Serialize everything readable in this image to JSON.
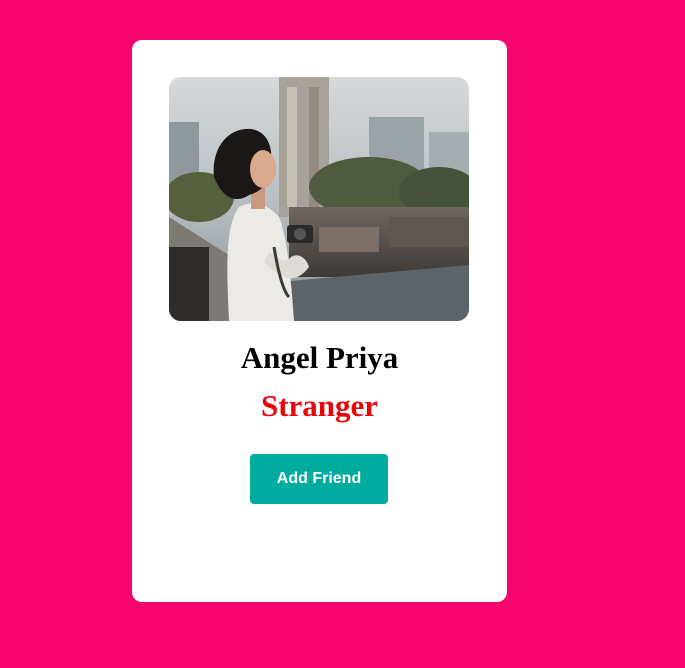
{
  "colors": {
    "background": "#f5066f",
    "card": "#ffffff",
    "name_text": "#000000",
    "status_text": "#e8060a",
    "button": "#00aba0",
    "button_text": "#ffffff"
  },
  "profile": {
    "photo_icon": "profile-photo",
    "name": "Angel Priya",
    "status": "Stranger"
  },
  "actions": {
    "add_friend_label": "Add Friend"
  }
}
